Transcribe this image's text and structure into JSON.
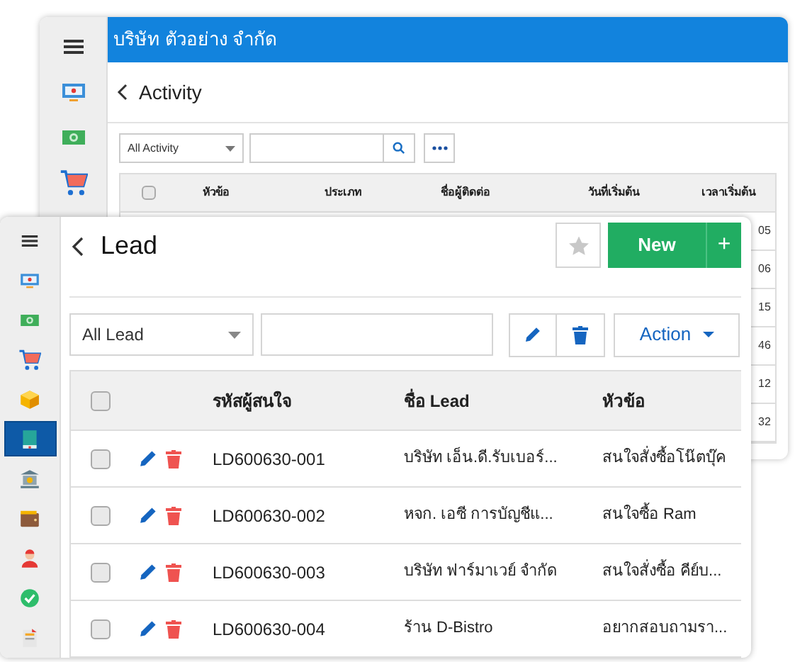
{
  "back_window": {
    "company": "บริษัท ตัวอย่าง จำกัด",
    "title": "Activity",
    "filter": "All Activity",
    "header_checked": false,
    "sidebar": [
      {
        "kind": "menu",
        "selected": false
      },
      {
        "kind": "monitor",
        "selected": false
      },
      {
        "kind": "money",
        "selected": false
      },
      {
        "kind": "cart",
        "selected": false
      }
    ],
    "columns": [
      "หัวข้อ",
      "ประเภท",
      "ชื่อผู้ติดต่อ",
      "วันที่เริ่มต้น",
      "เวลาเริ่มต้น"
    ],
    "rows": [
      {
        "start_time": "05"
      },
      {
        "start_time": "06"
      },
      {
        "start_time": "15"
      },
      {
        "start_time": "46"
      },
      {
        "start_time": "12"
      },
      {
        "start_time": "32"
      }
    ]
  },
  "front_window": {
    "title": "Lead",
    "new_button": "New",
    "plus_button": "+",
    "filter": "All Lead",
    "action_button": "Action",
    "header_checked": false,
    "sidebar": [
      {
        "kind": "menu",
        "selected": false
      },
      {
        "kind": "monitor",
        "selected": false
      },
      {
        "kind": "money",
        "selected": false
      },
      {
        "kind": "cart",
        "selected": false
      },
      {
        "kind": "box",
        "selected": false
      },
      {
        "kind": "book",
        "selected": true
      },
      {
        "kind": "bank",
        "selected": false
      },
      {
        "kind": "wallet",
        "selected": false
      },
      {
        "kind": "person",
        "selected": false
      },
      {
        "kind": "check",
        "selected": false
      },
      {
        "kind": "document",
        "selected": false
      }
    ],
    "columns": [
      "รหัสผู้สนใจ",
      "ชื่อ Lead",
      "หัวข้อ"
    ],
    "rows": [
      {
        "checked": false,
        "code": "LD600630-001",
        "name": "บริษัท เอ็น.ดี.รับเบอร์...",
        "topic": "สนใจสั่งซื้อโน๊ตบุ๊ค"
      },
      {
        "checked": false,
        "code": "LD600630-002",
        "name": "หจก. เอซี การบัญชีแ...",
        "topic": "สนใจซื้อ Ram"
      },
      {
        "checked": false,
        "code": "LD600630-003",
        "name": "บริษัท ฟาร์มาเวย์ จำกัด",
        "topic": "สนใจสั่งซื้อ คีย์บ..."
      },
      {
        "checked": false,
        "code": "LD600630-004",
        "name": "ร้าน D-Bistro",
        "topic": "อยากสอบถามรา..."
      }
    ]
  }
}
